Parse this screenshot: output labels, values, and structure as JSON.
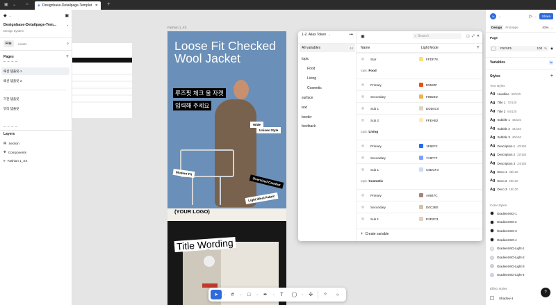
{
  "browser": {
    "tab_title": "Designbase-Detailpage-Templat",
    "new_tab": "+"
  },
  "left_panel": {
    "file_name": "Designbase-Detailpage-Tem...",
    "subtitle": "Design System",
    "tabs": [
      "File",
      "Assets"
    ],
    "pages_title": "Pages",
    "pages": [
      "패션 템플릿-1",
      "패션 템플릿-2",
      "가전 템플릿",
      "뷰티 템플릿"
    ],
    "layers_title": "Layers",
    "layers": [
      "Section",
      "Components",
      "Fashion 1_XX"
    ]
  },
  "canvas": {
    "frame_label": "Fashion 1_XX"
  },
  "hero": {
    "title": "Loose Fit Checked Wool Jacket",
    "kr_line1": "루즈핏 체크 울 자켓",
    "kr_line2": "입력해 주세요",
    "tags": [
      "Wide",
      "Unisex Style",
      "Modern Fit",
      "Oversized Comfort",
      "Light Wool Fabric"
    ],
    "logo": "(YOUR LOGO)",
    "title2": "Title Wording"
  },
  "variables": {
    "collection": "1-2. Alias Token",
    "search_placeholder": "Search",
    "all_label": "All variables",
    "all_count": "44",
    "groups": [
      "topic",
      "Food",
      "Living",
      "Cosmetic",
      "surface",
      "text",
      "border",
      "feedback"
    ],
    "col_name": "Name",
    "col_mode": "Light Mode",
    "rows": [
      {
        "type": "item",
        "name": "Star",
        "value": "FFDF78",
        "color": "#FFDF78"
      },
      {
        "type": "header",
        "path": "topic / ",
        "bold": "Food"
      },
      {
        "type": "item",
        "name": "Primary",
        "value": "E5530F",
        "color": "#E5530F"
      },
      {
        "type": "item",
        "name": "Secondary",
        "value": "F0B24D",
        "color": "#F0B24D"
      },
      {
        "type": "item",
        "name": "Sub 1",
        "value": "DDD4C0",
        "color": "#DDD4C0"
      },
      {
        "type": "item",
        "name": "Sub 2",
        "value": "FFEAB2",
        "color": "#FFEAB2"
      },
      {
        "type": "header",
        "path": "topic / ",
        "bold": "Living"
      },
      {
        "type": "item",
        "name": "Primary",
        "value": "1E6EF2",
        "color": "#1E6EF2"
      },
      {
        "type": "item",
        "name": "Secondary",
        "value": "7A9FFF",
        "color": "#7A9FFF"
      },
      {
        "type": "item",
        "name": "Sub 1",
        "value": "C8DCF3",
        "color": "#C8DCF3"
      },
      {
        "type": "header",
        "path": "topic / ",
        "bold": "Cosmetic"
      },
      {
        "type": "item",
        "name": "Primary",
        "value": "A6847C",
        "color": "#A6847C"
      },
      {
        "type": "item",
        "name": "Secondary",
        "value": "D0C2B0",
        "color": "#D0C2B0"
      },
      {
        "type": "item",
        "name": "Sub 1",
        "value": "E2D2C3",
        "color": "#E2D2C3"
      }
    ],
    "create": "Create variable"
  },
  "right_panel": {
    "avatar": "Jo",
    "share": "Share",
    "tabs": [
      "Design",
      "Prototype"
    ],
    "zoom": "41%",
    "page_title": "Page",
    "page_fill": "F5F5F5",
    "page_opacity": "100",
    "page_pct": "%",
    "variables_title": "Variables",
    "styles_title": "Styles",
    "text_styles_title": "Text styles",
    "text_styles": [
      {
        "name": "Headline",
        "spec": "60/120"
      },
      {
        "name": "Title 1",
        "spec": "72/120"
      },
      {
        "name": "Title 2",
        "spec": "64/120"
      },
      {
        "name": "Subtitle 1",
        "spec": "48/140"
      },
      {
        "name": "Subtitle 2",
        "spec": "44/140"
      },
      {
        "name": "Subtitle 3",
        "spec": "40/140"
      },
      {
        "name": "Description 1",
        "spec": "40/150"
      },
      {
        "name": "Description 2",
        "spec": "32/150"
      },
      {
        "name": "Description 3",
        "spec": "24/150"
      },
      {
        "name": "Deco 1",
        "spec": "48/120"
      },
      {
        "name": "Deco 2",
        "spec": "20/120"
      },
      {
        "name": "Deco 3",
        "spec": "18/120"
      }
    ],
    "color_styles_title": "Color styles",
    "color_styles": [
      {
        "name": "Gradient-BG-1",
        "color": "#1a1a1a"
      },
      {
        "name": "Gradient-BG-2",
        "color": "#1a1a1a"
      },
      {
        "name": "Gradient-BG-3",
        "color": "#1a1a1a"
      },
      {
        "name": "Gradient-BG-4",
        "color": "#1a1a1a"
      },
      {
        "name": "Gradient-BG-Light-1",
        "color": "#e8e8e8"
      },
      {
        "name": "Gradient-BG-Light-2",
        "color": "#dcd6f0"
      },
      {
        "name": "Gradient-BG-Light-3",
        "color": "#cfcaf5"
      },
      {
        "name": "Gradient-BG-Light-4",
        "color": "#c8d8ee"
      }
    ],
    "effect_styles_title": "Effect styles",
    "effects": [
      "Shadow-1"
    ],
    "help": "?"
  },
  "toolbar": {
    "icons": [
      "move-tool-icon",
      "frame-tool-icon",
      "shape-tool-icon",
      "pen-tool-icon",
      "text-tool-icon",
      "comment-tool-icon",
      "actions-icon",
      "dev-mode-icon",
      "code-icon"
    ]
  }
}
